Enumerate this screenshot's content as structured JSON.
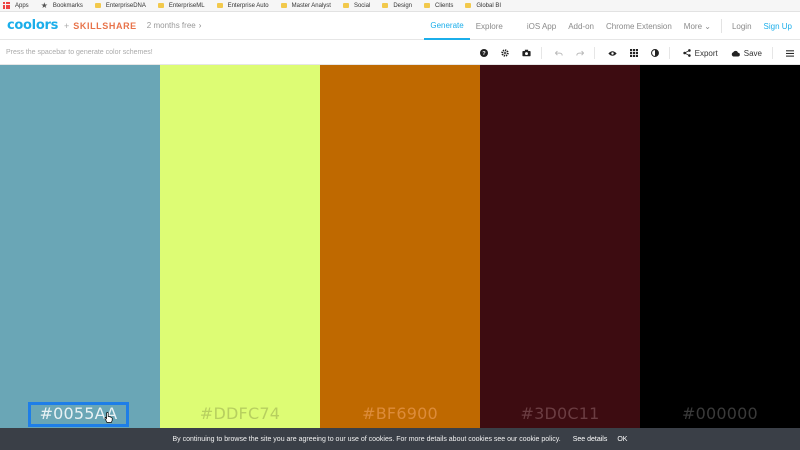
{
  "bookmarks": {
    "items": [
      {
        "label": "Apps",
        "icon": "apps-icon"
      },
      {
        "label": "Bookmarks",
        "icon": "star-icon"
      },
      {
        "label": "EnterpriseDNA",
        "icon": "folder-icon"
      },
      {
        "label": "EnterpriseML",
        "icon": "folder-icon"
      },
      {
        "label": "Enterprise Auto",
        "icon": "folder-icon"
      },
      {
        "label": "Master Analyst",
        "icon": "folder-icon"
      },
      {
        "label": "Social",
        "icon": "folder-icon"
      },
      {
        "label": "Design",
        "icon": "folder-icon"
      },
      {
        "label": "Clients",
        "icon": "folder-icon"
      },
      {
        "label": "Global BI",
        "icon": "folder-icon"
      }
    ]
  },
  "nav": {
    "logo": "coolors",
    "plus": "+",
    "partner": "SKILLSHARE",
    "promo": "2 months free",
    "links": [
      {
        "label": "Generate",
        "active": true
      },
      {
        "label": "Explore",
        "active": false
      },
      {
        "label": "iOS App",
        "active": false
      },
      {
        "label": "Add-on",
        "active": false
      },
      {
        "label": "Chrome Extension",
        "active": false
      },
      {
        "label": "More ⌄",
        "active": false
      }
    ],
    "login": "Login",
    "signup": "Sign Up",
    "accent": "#1baeea"
  },
  "toolbar": {
    "hint": "Press the spacebar to generate color schemes!",
    "export_label": "Export",
    "save_label": "Save"
  },
  "palette": {
    "colors": [
      {
        "hex": "#0055AA",
        "display": "#0055AA",
        "bg": "#6aa6b6",
        "text": "#ffffff",
        "selected": true
      },
      {
        "hex": "#DDFC74",
        "display": "#DDFC74",
        "bg": "#ddfc74",
        "text": "#b7cf5f",
        "selected": false
      },
      {
        "hex": "#BF6900",
        "display": "#BF6900",
        "bg": "#bf6900",
        "text": "#dd8c3a",
        "selected": false
      },
      {
        "hex": "#3D0C11",
        "display": "#3D0C11",
        "bg": "#3d0c11",
        "text": "#6b3d42",
        "selected": false
      },
      {
        "hex": "#000000",
        "display": "#000000",
        "bg": "#000000",
        "text": "#3a3a3a",
        "selected": false
      }
    ],
    "selection_color": "#1e7ee8"
  },
  "cookie": {
    "message": "By continuing to browse the site you are agreeing to our use of cookies. For more details about cookies see our cookie policy.",
    "details_label": "See details",
    "ok_label": "OK"
  }
}
